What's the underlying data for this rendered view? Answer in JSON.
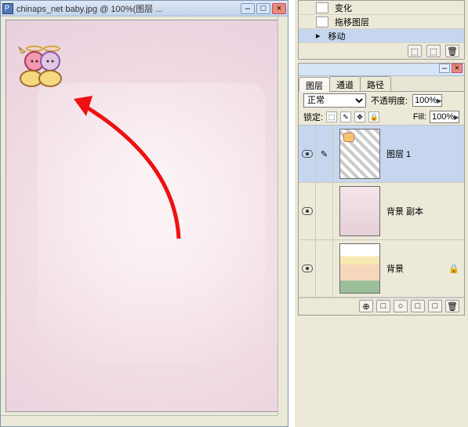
{
  "window": {
    "title": "chinaps_net baby.jpg @ 100%(图层 ...",
    "minimize_icon": "–",
    "maximize_icon": "□",
    "close_icon": "×"
  },
  "history": {
    "items": [
      {
        "label": "变化",
        "icon": "□"
      },
      {
        "label": "拖移图层",
        "icon": "□"
      },
      {
        "label": "移动",
        "icon": "▹",
        "active": true
      }
    ],
    "foot_icons": [
      "⬚",
      "⬚",
      "🗑"
    ]
  },
  "layers_panel": {
    "top_icons": {
      "min": "–",
      "close": "×"
    },
    "tabs": [
      {
        "label": "图层",
        "active": true
      },
      {
        "label": "通道",
        "active": false
      },
      {
        "label": "路径",
        "active": false
      }
    ],
    "blend_label": "正常",
    "opacity_label": "不透明度:",
    "opacity_value": "100%",
    "lock_label": "锁定:",
    "fill_label": "Fill:",
    "fill_value": "100%",
    "layers": [
      {
        "name": "图层 1",
        "thumb": "checker",
        "visible": true,
        "selected": true
      },
      {
        "name": "背景 副本",
        "thumb": "pink",
        "visible": true,
        "selected": false
      },
      {
        "name": "背景",
        "thumb": "photo",
        "visible": true,
        "selected": false,
        "locked": true
      }
    ],
    "foot_icons": [
      "⊕",
      "□",
      "○",
      "□",
      "□",
      "🗑"
    ]
  }
}
